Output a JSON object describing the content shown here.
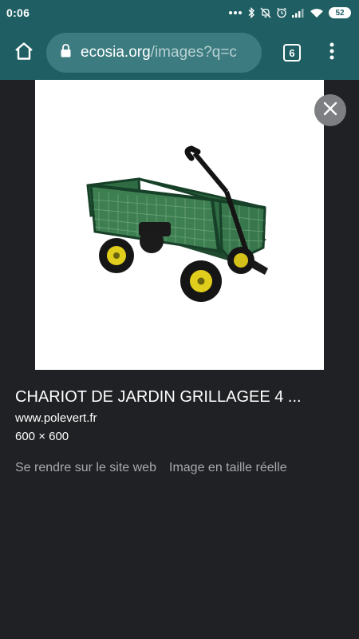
{
  "status_bar": {
    "time": "0:06",
    "battery": "52",
    "icons": [
      "more-dots-icon",
      "bluetooth-icon",
      "notifications-off-icon",
      "alarm-icon",
      "signal-icon",
      "wifi-icon",
      "battery-icon"
    ]
  },
  "toolbar": {
    "url_domain": "ecosia.org",
    "url_path": "/images?q=c",
    "tab_count": "6",
    "colors": {
      "bar": "#1f5f63",
      "omnibox": "#3c7c80"
    }
  },
  "result": {
    "title": "CHARIOT DE JARDIN GRILLAGEE 4 ...",
    "domain": "www.polevert.fr",
    "size": "600 × 600",
    "visit_link": "Se rendre sur le site web",
    "full_size_link": "Image en taille réelle"
  }
}
